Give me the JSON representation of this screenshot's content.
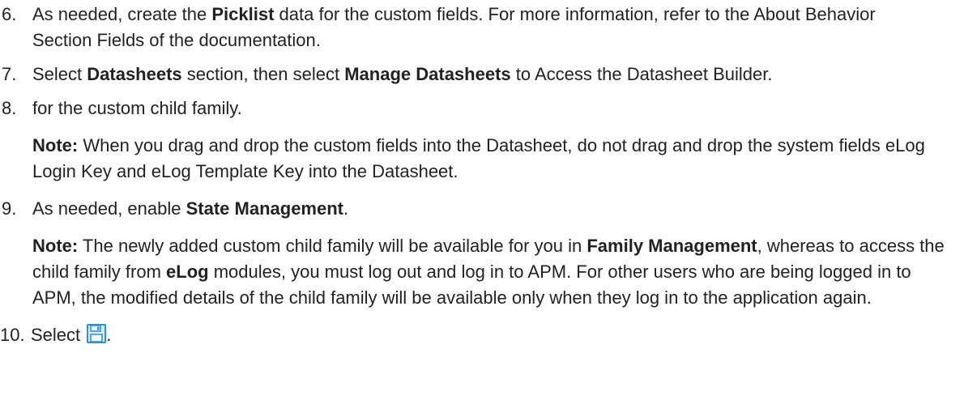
{
  "steps": [
    {
      "number": "6.",
      "parts": {
        "a": "As needed, create the ",
        "b": "Picklist",
        "c": " data for the custom fields. For more information, refer to the About Behavior Section Fields of the documentation."
      }
    },
    {
      "number": "7.",
      "parts": {
        "a": "Select ",
        "b": "Datasheets",
        "c": " section, then select ",
        "d": "Manage Datasheets",
        "e": " to Access the Datasheet Builder."
      }
    },
    {
      "number": "8.",
      "text": "for the custom child family.",
      "note": {
        "label": "Note:",
        "text": " When you drag and drop the custom fields into the Datasheet, do not drag and drop the system fields eLog Login Key and eLog Template Key into the Datasheet."
      }
    },
    {
      "number": "9.",
      "parts": {
        "a": "As needed, enable ",
        "b": "State Management",
        "c": "."
      },
      "note": {
        "label": "Note:",
        "a": " The newly added custom child family will be available for you in ",
        "b": "Family Management",
        "c": ", whereas to access the child family from ",
        "d": "eLog",
        "e": " modules, you must log out and log in to APM. For other users who are being logged in to APM, the modified details of the child family will be available only when they log in to the application again."
      }
    },
    {
      "number": "10.",
      "text": "Select ",
      "icon": "save-icon",
      "after": "."
    }
  ],
  "colors": {
    "text": "#222222",
    "icon_blue": "#2f8fd8"
  }
}
